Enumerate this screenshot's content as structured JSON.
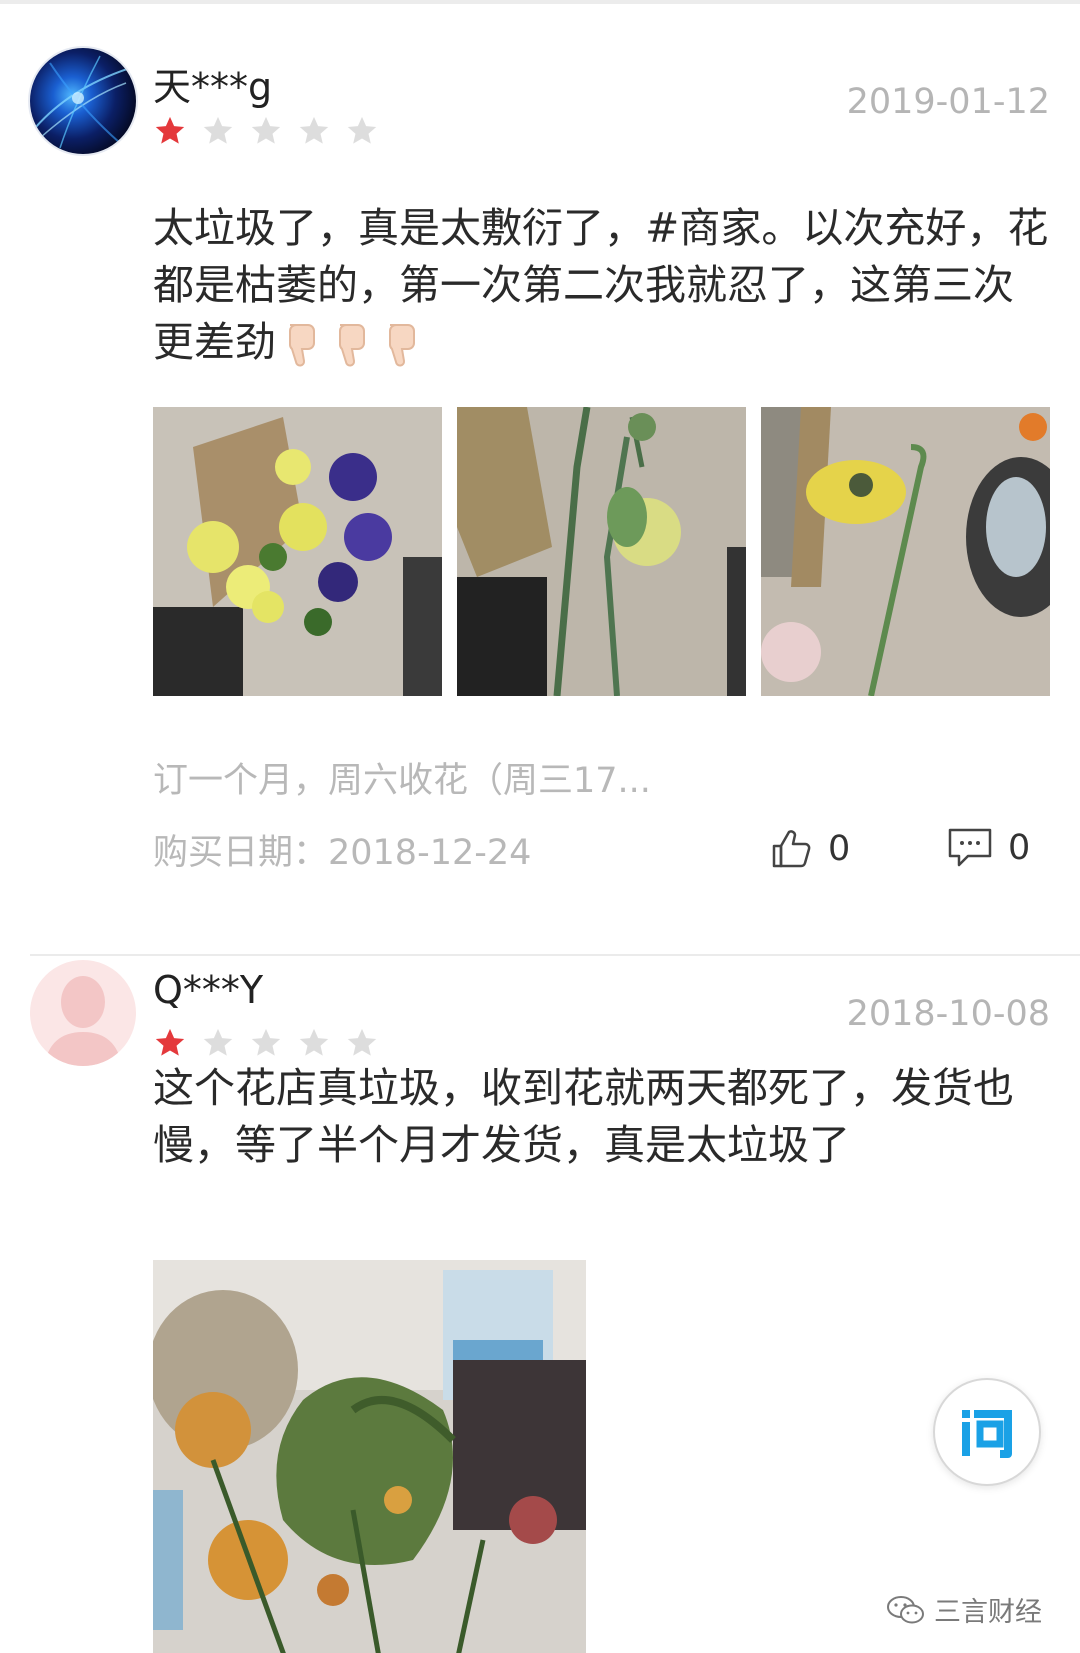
{
  "reviews": [
    {
      "username": "天***g",
      "date": "2019-01-12",
      "rating": 1,
      "max_rating": 5,
      "text": "太垃圾了，真是太敷衍了，#商家。以次充好，花都是枯萎的，第一次第二次我就忍了，这第三次更差劲",
      "emojis": [
        "thumbs-down",
        "thumbs-down",
        "thumbs-down"
      ],
      "photos": [
        "yellow-purple-bouquet",
        "wilted-carnations",
        "drooping-sunflower"
      ],
      "sku_text": "订一个月，周六收花（周三17...",
      "purchase_date": "购买日期：2018-12-24",
      "likes": "0",
      "comments": "0"
    },
    {
      "username": "Q***Y",
      "date": "2018-10-08",
      "rating": 1,
      "max_rating": 5,
      "text": "这个花店真垃圾，收到花就两天都死了，发货也慢，等了半个月才发货，真是太垃圾了",
      "photos": [
        "dead-flowers-vase"
      ]
    }
  ],
  "ask_button": {
    "icon": "ask-icon",
    "color": "#1aa1e6"
  },
  "watermark": {
    "label": "三言财经",
    "icon": "wechat-icon"
  },
  "colors": {
    "star_active": "#e4393c",
    "star_inactive": "#dddddd",
    "muted_text": "#b8b8b8"
  }
}
